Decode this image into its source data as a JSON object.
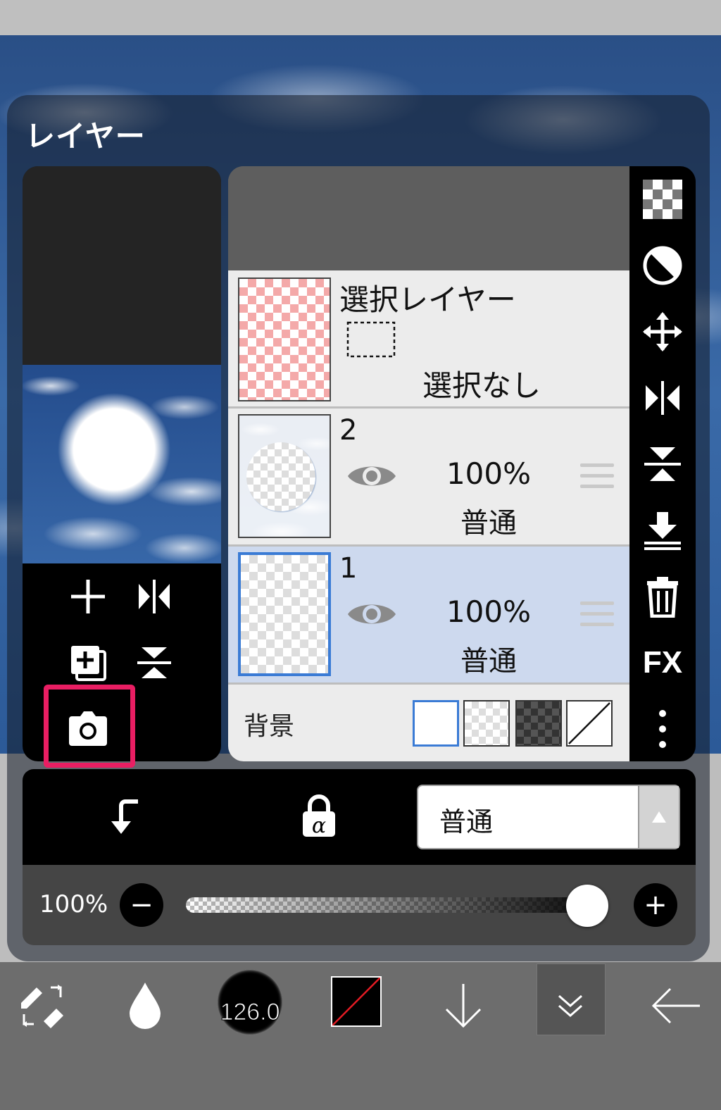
{
  "panel": {
    "title": "レイヤー"
  },
  "layers": [
    {
      "kind": "selection",
      "name": "選択レイヤー",
      "status": "選択なし"
    },
    {
      "kind": "layer",
      "number": "2",
      "opacity": "100%",
      "blend": "普通",
      "visible": true,
      "selected": false
    },
    {
      "kind": "layer",
      "number": "1",
      "opacity": "100%",
      "blend": "普通",
      "visible": true,
      "selected": true
    }
  ],
  "background": {
    "label": "背景",
    "options": [
      "white",
      "transparent-light",
      "transparent-dark",
      "none"
    ],
    "selected": "white"
  },
  "controls": {
    "blend_mode": {
      "value": "普通"
    },
    "opacity": {
      "label": "100%",
      "value": 100,
      "minus": "−",
      "plus": "+"
    }
  },
  "right_tools": [
    "checker-icon",
    "contrast-icon",
    "move-icon",
    "flip-horizontal-icon",
    "flip-vertical-icon",
    "merge-down-icon",
    "trash-icon",
    "fx-icon",
    "more-vertical-icon"
  ],
  "right_tool_labels": {
    "fx": "FX"
  },
  "left_tools": [
    "add-layer-icon",
    "flip-horizontal-icon",
    "duplicate-layer-icon",
    "flip-vertical-icon",
    "camera-icon"
  ],
  "bottom_toolbar": {
    "brush_size": "126.0",
    "items": [
      "transform-icon",
      "drop-icon",
      "brush-size",
      "color-swatch",
      "arrow-down-icon",
      "collapse-icon",
      "back-arrow-icon"
    ],
    "active": "collapse-icon"
  },
  "colors": {
    "highlight": "#e91e63",
    "selected_row": "#cdd9ee",
    "accent": "#3a7bd5"
  }
}
